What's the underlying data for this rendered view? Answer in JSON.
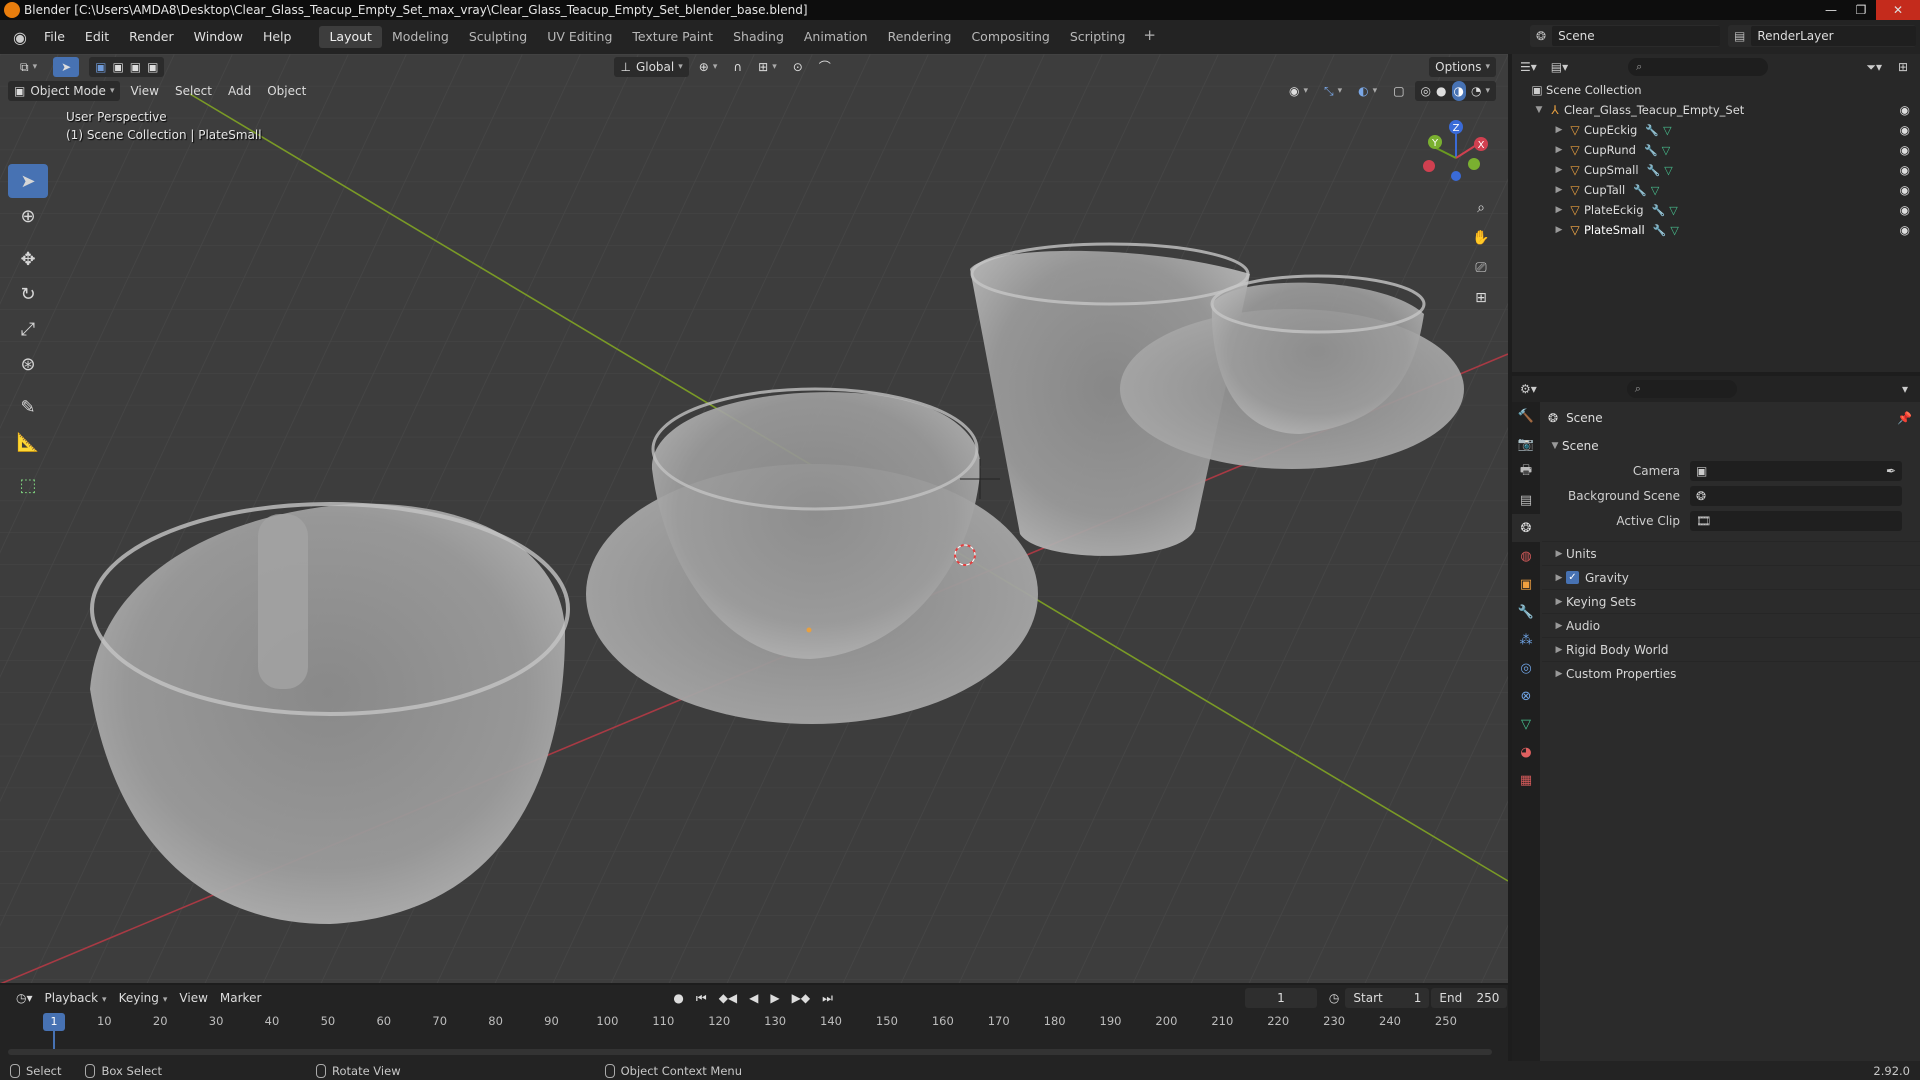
{
  "window": {
    "title": "Blender [C:\\Users\\AMDA8\\Desktop\\Clear_Glass_Teacup_Empty_Set_max_vray\\Clear_Glass_Teacup_Empty_Set_blender_base.blend]",
    "minimize": "—",
    "maximize": "❐",
    "close": "✕"
  },
  "topbar": {
    "menus": [
      "File",
      "Edit",
      "Render",
      "Window",
      "Help"
    ],
    "workspaces": [
      "Layout",
      "Modeling",
      "Sculpting",
      "UV Editing",
      "Texture Paint",
      "Shading",
      "Animation",
      "Rendering",
      "Compositing",
      "Scripting"
    ],
    "active_workspace": "Layout",
    "add_tab": "+",
    "scene": "Scene",
    "view_layer": "RenderLayer"
  },
  "viewport": {
    "mode": "Object Mode",
    "menus": [
      "View",
      "Select",
      "Add",
      "Object"
    ],
    "transform_orientation": "Global",
    "options": "Options",
    "perspective_label": "User Perspective",
    "collection_label": "(1) Scene Collection | PlateSmall",
    "axis_x": "X",
    "axis_y": "Y",
    "axis_z": "Z",
    "grid_color": "#474747",
    "x_axis_color": "#a83a44",
    "y_axis_color": "#7a9a26"
  },
  "outliner": {
    "search_placeholder": "",
    "root": "Scene Collection",
    "collection": "Clear_Glass_Teacup_Empty_Set",
    "objects": [
      "CupEckig",
      "CupRund",
      "CupSmall",
      "CupTall",
      "PlateEckig",
      "PlateSmall"
    ]
  },
  "properties": {
    "context": "Scene",
    "panel": "Scene",
    "fields": [
      {
        "label": "Camera",
        "value": ""
      },
      {
        "label": "Background Scene",
        "value": ""
      },
      {
        "label": "Active Clip",
        "value": ""
      }
    ],
    "subpanels": [
      "Units",
      "Gravity",
      "Keying Sets",
      "Audio",
      "Rigid Body World",
      "Custom Properties"
    ],
    "gravity_checked": true
  },
  "timeline": {
    "menus": [
      "Playback",
      "Keying",
      "View",
      "Marker"
    ],
    "current_frame": "1",
    "start_label": "Start",
    "start": "1",
    "end_label": "End",
    "end": "250",
    "ticks": [
      "10",
      "20",
      "30",
      "40",
      "50",
      "60",
      "70",
      "80",
      "90",
      "100",
      "110",
      "120",
      "130",
      "140",
      "150",
      "160",
      "170",
      "180",
      "190",
      "200",
      "210",
      "220",
      "230",
      "240",
      "250"
    ],
    "cursor_label": "1"
  },
  "statusbar": {
    "select": "Select",
    "box_select": "Box Select",
    "rotate_view": "Rotate View",
    "context_menu": "Object Context Menu",
    "version": "2.92.0"
  }
}
